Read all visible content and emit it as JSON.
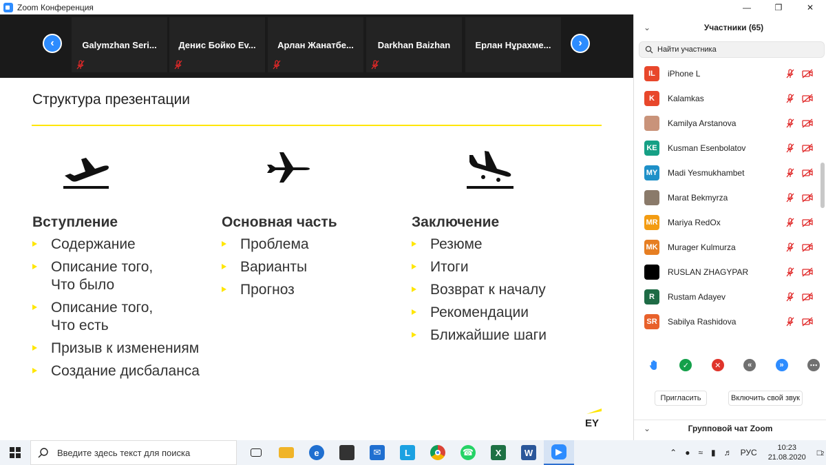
{
  "window": {
    "title": "Zoom Конференция"
  },
  "gallery": {
    "participants": [
      "Galymzhan Seri...",
      "Денис Бойко Ev...",
      "Арлан Жанатбе...",
      "Darkhan Baizhan",
      "Ерлан Нұрахме..."
    ]
  },
  "slide": {
    "title": "Структура презентации",
    "columns": [
      {
        "heading": "Вступление",
        "items": [
          "Содержание",
          "Описание того,\nЧто было",
          "Описание того,\nЧто есть",
          "Призыв к изменениям",
          "Создание дисбаланса"
        ]
      },
      {
        "heading": "Основная часть",
        "items": [
          "Проблема",
          "Варианты",
          "Прогноз"
        ]
      },
      {
        "heading": "Заключение",
        "items": [
          "Резюме",
          "Итоги",
          "Возврат к началу",
          "Рекомендации",
          "Ближайшие шаги"
        ]
      }
    ],
    "logo_text": "EY"
  },
  "participants_panel": {
    "title": "Участники (65)",
    "search_placeholder": "Найти участника",
    "list": [
      {
        "initials": "IL",
        "name": "iPhone L",
        "color": "#e8472b"
      },
      {
        "initials": "K",
        "name": "Kalamkas",
        "color": "#e8472b"
      },
      {
        "initials": "",
        "name": "Kamilya Arstanova",
        "color": "#c9937a"
      },
      {
        "initials": "KE",
        "name": "Kusman Esenbolatov",
        "color": "#16a085"
      },
      {
        "initials": "MY",
        "name": "Madi Yesmukhambet",
        "color": "#1e90c8"
      },
      {
        "initials": "",
        "name": "Marat Bekmyrza",
        "color": "#8a7a6a"
      },
      {
        "initials": "MR",
        "name": "Mariya RedOx",
        "color": "#f39c12"
      },
      {
        "initials": "MK",
        "name": "Murager Kulmurza",
        "color": "#e67e22"
      },
      {
        "initials": "",
        "name": "RUSLAN ZHAGYPAR",
        "color": "#000000"
      },
      {
        "initials": "R",
        "name": "Rustam Adayev",
        "color": "#1e6b45"
      },
      {
        "initials": "SR",
        "name": "Sabilya Rashidova",
        "color": "#e8612b"
      }
    ],
    "invite_label": "Пригласить",
    "unmute_label": "Включить свой звук",
    "chat_title": "Групповой чат Zoom"
  },
  "taskbar": {
    "search_placeholder": "Введите здесь текст для поиска",
    "language": "РУС",
    "time": "10:23",
    "date": "21.08.2020",
    "notifications": "2"
  }
}
